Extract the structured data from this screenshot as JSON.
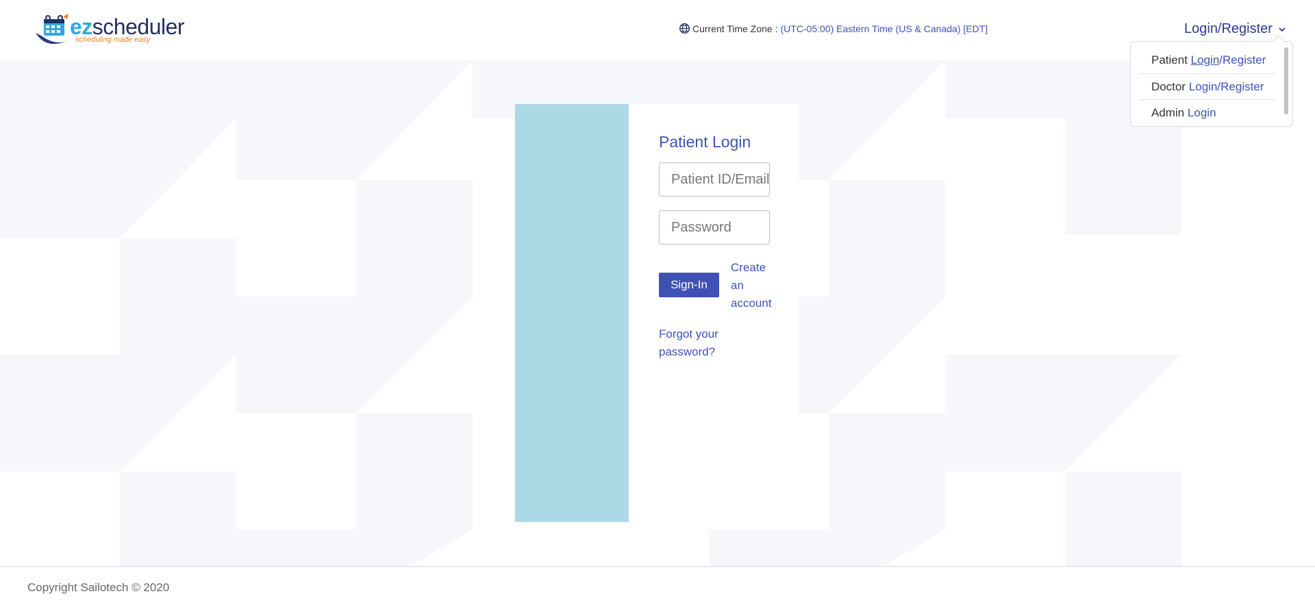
{
  "brand": {
    "name_part1": "ez",
    "name_part2": "scheduler",
    "tagline": "scheduling made easy"
  },
  "header": {
    "timezone_label": "Current Time Zone :",
    "timezone_value": "(UTC-05:00) Eastern Time (US & Canada) [EDT]",
    "login_menu_label": "Login/Register"
  },
  "dropdown": {
    "items": [
      {
        "prefix": "Patient",
        "login": "Login",
        "sep": "/",
        "register": "Register"
      },
      {
        "prefix": "Doctor",
        "login": "Login",
        "sep": "/",
        "register": "Register"
      },
      {
        "prefix": "Admin",
        "login": "Login"
      }
    ]
  },
  "login_form": {
    "title": "Patient Login",
    "id_placeholder": "Patient ID/Email",
    "password_placeholder": "Password",
    "signin_label": "Sign-In",
    "create_account_label": "Create an account",
    "forgot_password_label": "Forgot your password?"
  },
  "footer": {
    "copyright": "Copyright Sailotech © 2020"
  },
  "colors": {
    "primary": "#3f51b5",
    "image_panel": "#add8e6",
    "background_pattern": "#f7f8fc"
  }
}
